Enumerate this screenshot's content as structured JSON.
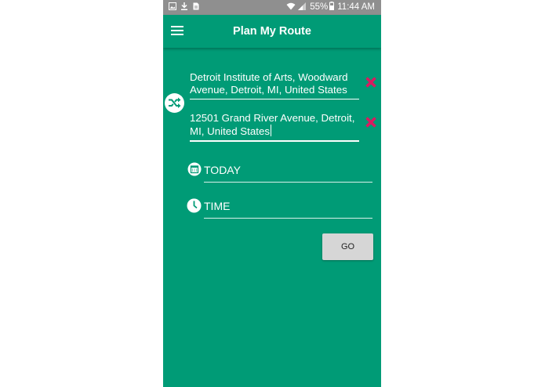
{
  "status_bar": {
    "battery_percent": "55%",
    "time": "11:44 AM",
    "icons": [
      "gallery-icon",
      "download-icon",
      "file-icon",
      "wifi-icon",
      "signal-icon",
      "battery-icon"
    ]
  },
  "app_bar": {
    "title": "Plan My Route",
    "menu_icon": "hamburger-menu-icon"
  },
  "route": {
    "origin": "Detroit Institute of Arts, Woodward Avenue, Detroit, MI, United States",
    "destination": "12501 Grand River Avenue, Detroit, MI, United States",
    "swap_icon": "swap-icon",
    "clear_icon": "close-icon"
  },
  "date_field": {
    "value": "TODAY",
    "icon": "calendar-icon"
  },
  "time_field": {
    "value": "TIME",
    "icon": "clock-icon"
  },
  "go_button": {
    "label": "GO"
  },
  "colors": {
    "primary": "#009B76",
    "status_bar": "#8f8f8f",
    "clear_x": "#D81B60",
    "button": "#d6d6d6"
  }
}
